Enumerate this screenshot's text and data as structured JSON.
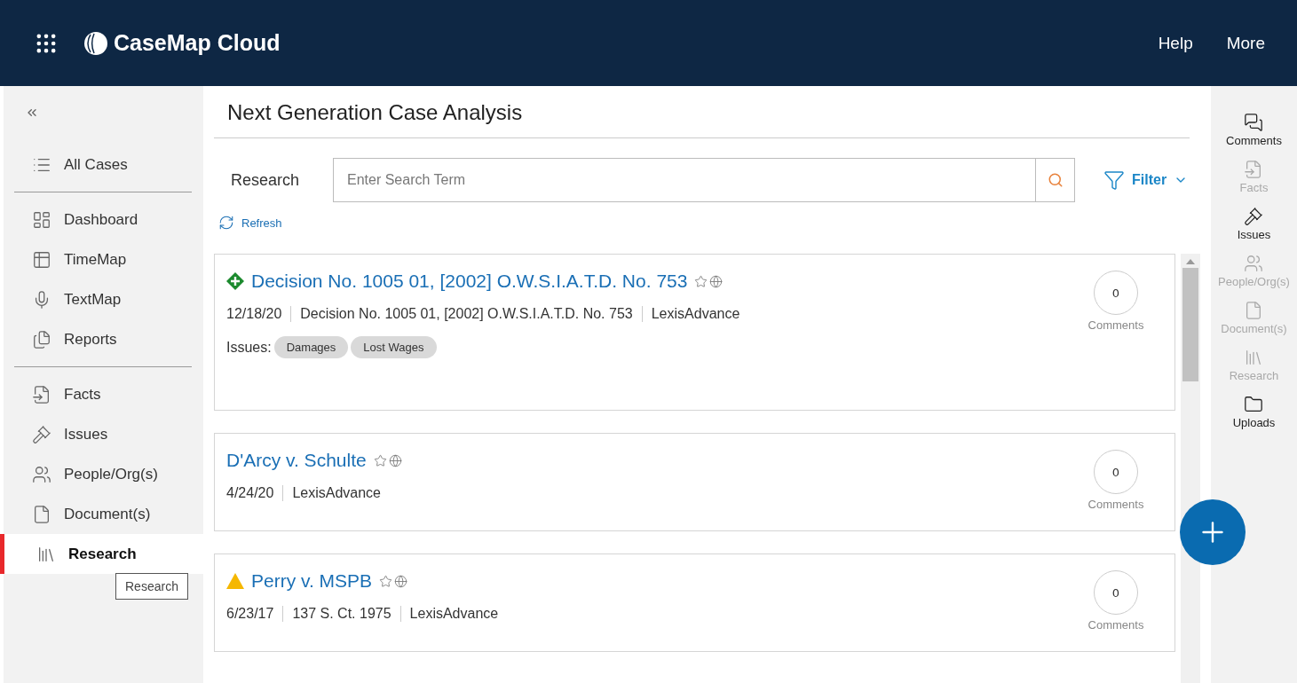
{
  "header": {
    "brand": "CaseMap",
    "brand_suffix": "Cloud",
    "links": [
      "Help",
      "More"
    ]
  },
  "sidebar": {
    "groups": [
      [
        {
          "label": "All Cases",
          "selected": false
        }
      ],
      [
        {
          "label": "Dashboard",
          "selected": false
        },
        {
          "label": "TimeMap",
          "selected": false
        },
        {
          "label": "TextMap",
          "selected": false
        },
        {
          "label": "Reports",
          "selected": false
        }
      ],
      [
        {
          "label": "Facts",
          "selected": false
        },
        {
          "label": "Issues",
          "selected": false
        },
        {
          "label": "People/Org(s)",
          "selected": false
        },
        {
          "label": "Document(s)",
          "selected": false
        },
        {
          "label": "Research",
          "selected": true
        }
      ]
    ],
    "tooltip": "Research"
  },
  "page": {
    "title": "Next Generation Case Analysis",
    "search_label": "Research",
    "search": {
      "placeholder": "Enter Search Term"
    },
    "filter": "Filter",
    "refresh": "Refresh"
  },
  "results": [
    {
      "kind": "added",
      "title": "Decision No. 1005 01, [2002] O.W.S.I.A.T.D. No. 753",
      "meta": [
        "12/18/20",
        "Decision No. 1005 01, [2002] O.W.S.I.A.T.D. No. 753",
        "LexisAdvance"
      ],
      "issues_label": "Issues:",
      "issues": [
        "Damages",
        "Lost Wages"
      ],
      "comment_count": "0",
      "comment_label": "Comments"
    },
    {
      "kind": "plain",
      "title": "D'Arcy v. Schulte",
      "meta": [
        "4/24/20",
        "LexisAdvance"
      ],
      "comment_count": "0",
      "comment_label": "Comments"
    },
    {
      "kind": "warning",
      "title": "Perry v. MSPB",
      "meta": [
        "6/23/17",
        "137 S. Ct. 1975",
        "LexisAdvance"
      ],
      "comment_count": "0",
      "comment_label": "Comments"
    }
  ],
  "rail": [
    {
      "label": "Comments",
      "disabled": false
    },
    {
      "label": "Facts",
      "disabled": true
    },
    {
      "label": "Issues",
      "disabled": false
    },
    {
      "label": "People/Org(s)",
      "disabled": true
    },
    {
      "label": "Document(s)",
      "disabled": true
    },
    {
      "label": "Research",
      "disabled": true
    },
    {
      "label": "Uploads",
      "disabled": false
    }
  ]
}
